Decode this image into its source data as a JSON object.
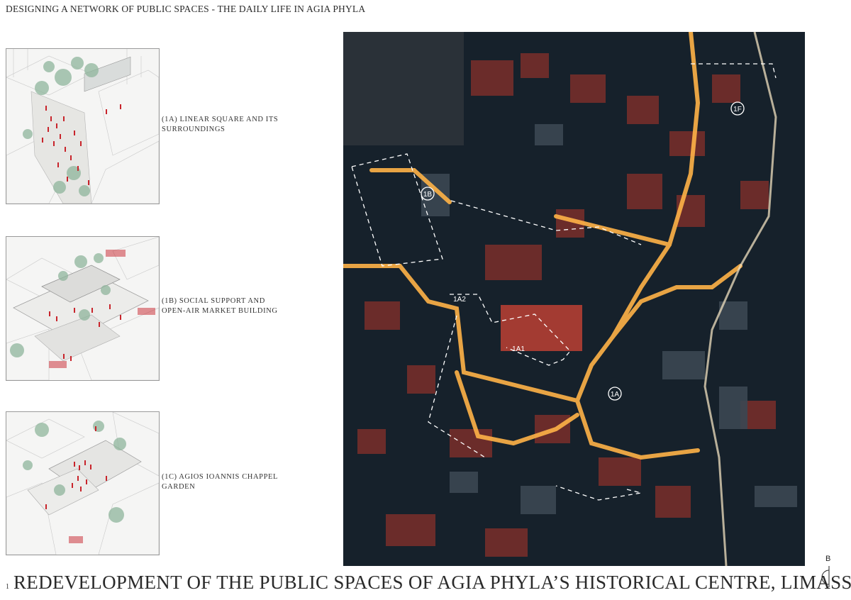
{
  "header": {
    "title": "DESIGNING A NETWORK OF PUBLIC SPACES - THE DAILY LIFE IN AGIA PHYLA"
  },
  "panels": [
    {
      "caption_line1": "(1A)  LINEAR SQUARE AND ITS",
      "caption_line2": "SURROUNDINGS"
    },
    {
      "caption_line1": "(1B)  SOCIAL SUPPORT AND",
      "caption_line2": "OPEN-AIR MARKET BUILDING"
    },
    {
      "caption_line1": "(1C) AGIOS IOANNIS CHAPPEL",
      "caption_line2": "GARDEN"
    }
  ],
  "map": {
    "markers": {
      "m1b": "1B",
      "m1f": "1F",
      "m1a": "1A",
      "m1a1": "1A1",
      "m1a2": "1A2"
    }
  },
  "footer": {
    "number": "1",
    "title": "REDEVELOPMENT OF THE PUBLIC SPACES OF AGIA PHYLA’S HISTORICAL CENTRE, LIMASSOL",
    "north_label": "B"
  },
  "colors": {
    "figure_red": "#c8242b",
    "street_light": "#ffb347",
    "roof_red": "#a33b32"
  }
}
